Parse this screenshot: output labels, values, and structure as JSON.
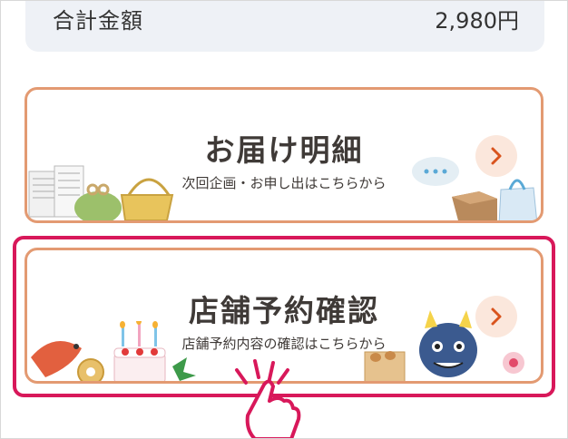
{
  "summary": {
    "label": "合計金額",
    "value": "2,980円"
  },
  "cards": [
    {
      "title": "お届け明細",
      "subtitle": "次回企画・お申し出はこちらから"
    },
    {
      "title": "店舗予約確認",
      "subtitle": "店舗予約内容の確認はこちらから"
    }
  ],
  "colors": {
    "card_border": "#e39a72",
    "highlight": "#d8185a",
    "arrow_bg": "#fbe7dc",
    "arrow": "#d9541e",
    "summary_bg": "#eef1f6"
  },
  "icons": [
    "chevron-right-icon",
    "tap-hand-icon"
  ]
}
